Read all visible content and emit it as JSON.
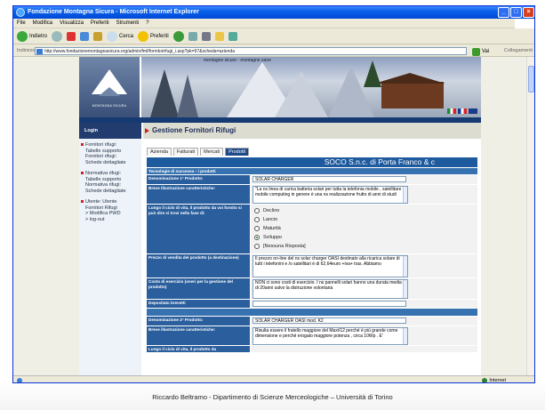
{
  "window": {
    "title": "Fondazione Montagna Sicura - Microsoft Internet Explorer"
  },
  "menubar": {
    "items": [
      "File",
      "Modifica",
      "Visualizza",
      "Preferiti",
      "Strumenti",
      "?"
    ]
  },
  "toolbar": {
    "back": "Indietro",
    "search": "Cerca",
    "favorites": "Preferiti"
  },
  "address": {
    "label": "Indirizzo",
    "url": "http://www.fondazionemontagnasicura.org/admin/fmf/fornitorirfugi_i.asp?pk=97&scheda=azienda",
    "go": "Vai",
    "links": "Collegamenti"
  },
  "status": {
    "zone": "Internet"
  },
  "banner": {
    "logo_text": "MONTAGNA SICURA",
    "caption": "montagne sicure - montagne sane"
  },
  "nav": {
    "login": "Login",
    "groups": [
      {
        "lines": [
          "Fornitori rifugi:",
          "Tabelle supporto",
          "Fornitori rifugi:",
          "Schede dettagliate"
        ]
      },
      {
        "lines": [
          "Normativa rifugi:",
          "Tabelle supporto",
          "Normativa rifugi:",
          "Schede dettagliate"
        ]
      },
      {
        "lines": [
          "Utente: Utente",
          "Fornitori Rifugi",
          "> Modifica PWD",
          "> log-out"
        ]
      }
    ]
  },
  "main": {
    "heading": "Gestione Fornitori Rifugi",
    "tabs": [
      "Azienda",
      "Fatturati",
      "Mercati",
      "Prodotti"
    ],
    "company": "SOCO S.n.c. di Porta Franco & c",
    "section1": "Tecnologie di successo - i prodotti",
    "rows": [
      {
        "label": "Denominazione 1° Prodotto:",
        "value": "SOLAR CHARGER"
      },
      {
        "label": "Breve illustrazione caratteristiche:",
        "value": "\"La ns linea di carica batteria solari per tutta la telefonia mobile , satellitare e mobile computing in genere è una ns realizzazione frutto di anni di studi"
      },
      {
        "label": "Lungo il ciclo di vita, il prodotto da voi fornito si può dire si trovi nella fase di:",
        "options": [
          "Declino",
          "Lancio",
          "Maturità",
          "Sviluppo",
          "[Nessuna Risposta]"
        ],
        "selected": "Sviluppo"
      },
      {
        "label": "Prezzo di vendita del prodotto (a destinazione)",
        "value": "Il prezzo on-line del ns solar charger OASI destinato alla ricarica solare di tutti i telefonini e /o satellitari è di 62,64euro +iva+ tras. Abbiamo"
      },
      {
        "label": "Costo di esercizio (oneri per la gestione del prodotto)",
        "value": "NON ci sono costi di esercizio. I ns pannelli solari hanno una durata media di 20anni salvo la distruzione volontaria"
      },
      {
        "label": "Depositato brevetti",
        "value": ""
      }
    ],
    "rows2": [
      {
        "label": "Denominazione 2° Prodotto:",
        "value": "SOLAR CHARGER OASI mod. K2"
      },
      {
        "label": "Breve illustrazione caratteristiche:",
        "value": "Risulta essere il fratello maggiore del Maxi/12 perché è più grande come dimensione e perché erogato maggiore potenza , circa 10Wp . E'"
      },
      {
        "label": "Lungo il ciclo di vita, il prodotto da",
        "value": ""
      }
    ]
  },
  "footer": "Riccardo Beltramo - Dipartimento di Scienze Merceologiche – Università di Torino"
}
